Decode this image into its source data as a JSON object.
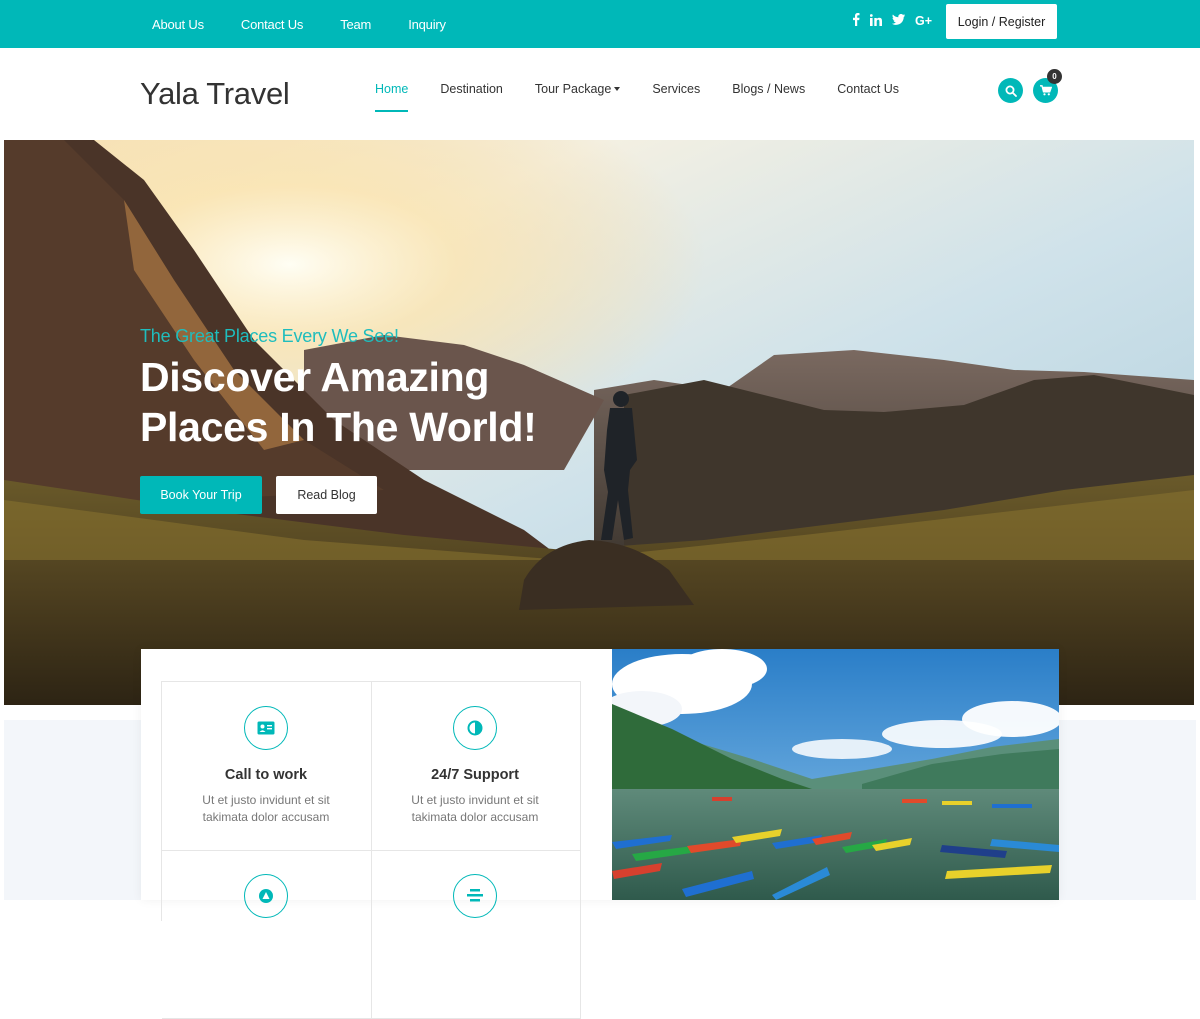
{
  "topbar": {
    "links": [
      "About Us",
      "Contact Us",
      "Team",
      "Inquiry"
    ],
    "social": {
      "facebook": "f",
      "linkedin": "in",
      "twitter": "t",
      "google_plus": "G+"
    },
    "login_label": "Login / Register"
  },
  "header": {
    "logo": "Yala Travel",
    "nav": [
      {
        "label": "Home",
        "active": true
      },
      {
        "label": "Destination"
      },
      {
        "label": "Tour Package",
        "dropdown": true
      },
      {
        "label": "Services"
      },
      {
        "label": "Blogs / News"
      },
      {
        "label": "Contact Us"
      }
    ],
    "cart_count": "0",
    "icons": {
      "search": "search-icon",
      "cart": "cart-icon"
    }
  },
  "hero": {
    "kicker": "The Great Places Every We See!",
    "headline_line1": "Discover Amazing",
    "headline_line2": "Places In The World!",
    "primary_button": "Book Your Trip",
    "secondary_button": "Read Blog"
  },
  "features": [
    {
      "title": "Call to work",
      "description": "Ut et justo invidunt et sit takimata dolor accusam",
      "icon": "id-card-icon"
    },
    {
      "title": "24/7 Support",
      "description": "Ut et justo invidunt et sit takimata dolor accusam",
      "icon": "half-circle-icon"
    },
    {
      "title": "",
      "description": "",
      "icon": "triangle-icon"
    },
    {
      "title": "",
      "description": "",
      "icon": "stack-icon"
    }
  ],
  "colors": {
    "accent": "#00b8b8",
    "text": "#333333",
    "muted": "#777777"
  }
}
